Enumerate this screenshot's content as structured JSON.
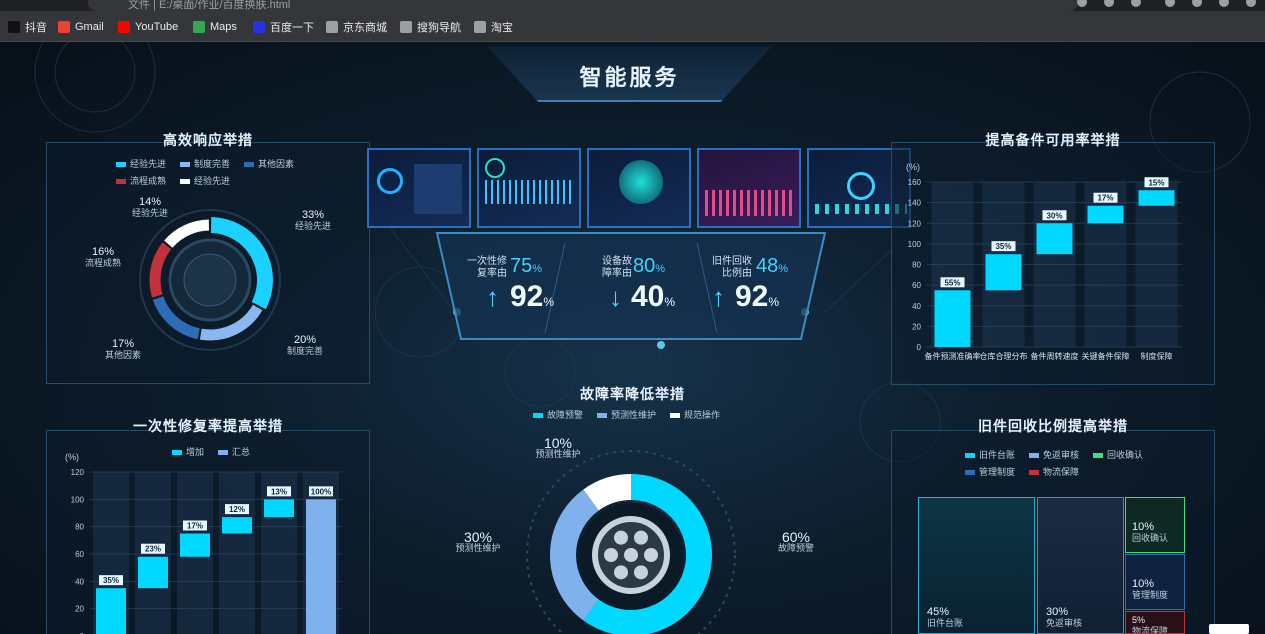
{
  "browser": {
    "url_text": "文件 | E:/桌面/作业/百度换肤.html",
    "bookmarks": [
      {
        "label": "抖音",
        "color": "#111111"
      },
      {
        "label": "Gmail",
        "color": "#ea4335"
      },
      {
        "label": "YouTube",
        "color": "#ff0000"
      },
      {
        "label": "Maps",
        "color": "#34a853"
      },
      {
        "label": "百度一下",
        "color": "#2932e1"
      },
      {
        "label": "京东商城",
        "color": "#9aa0a6"
      },
      {
        "label": "搜狗导航",
        "color": "#9aa0a6"
      },
      {
        "label": "淘宝",
        "color": "#9aa0a6"
      }
    ]
  },
  "header": {
    "title": "智能服务"
  },
  "panels": {
    "efficient": {
      "title": "高效响应举措",
      "legend": [
        "经验先进",
        "制度完善",
        "其他因素",
        "流程成熟",
        "经验先进"
      ],
      "slices": [
        {
          "value": "33%",
          "label": "经验先进"
        },
        {
          "value": "20%",
          "label": "制度完善"
        },
        {
          "value": "17%",
          "label": "其他因素"
        },
        {
          "value": "16%",
          "label": "流程成熟"
        },
        {
          "value": "14%",
          "label": "经验先进"
        }
      ]
    },
    "spare": {
      "title": "提高备件可用率举措",
      "unit": "(%)"
    },
    "repair": {
      "title": "一次性修复率提高举措",
      "unit": "(%)",
      "legend": [
        "增加",
        "汇总"
      ]
    },
    "fault": {
      "title": "故障率降低举措",
      "legend": [
        "故障预警",
        "预测性维护",
        "规范操作"
      ],
      "slices": [
        {
          "value": "10%",
          "label": "预测性维护"
        },
        {
          "value": "30%",
          "label": "预测性维护"
        },
        {
          "value": "60%",
          "label": "故障预警"
        }
      ]
    },
    "recycle": {
      "title": "旧件回收比例提高举措",
      "legend": [
        "旧件台账",
        "免返审核",
        "回收确认",
        "管理制度",
        "物流保障"
      ],
      "cells": [
        {
          "value": "45%",
          "label": "旧件台账"
        },
        {
          "value": "30%",
          "label": "免返审核"
        },
        {
          "value": "10%",
          "label": "回收确认"
        },
        {
          "value": "10%",
          "label": "管理制度"
        },
        {
          "value": "5%",
          "label": "物流保障"
        }
      ]
    }
  },
  "kpis": [
    {
      "label_l1": "一次性修",
      "label_l2": "复率由",
      "from": "75",
      "to": "92",
      "unit": "%",
      "arrow": "↑"
    },
    {
      "label_l1": "设备故",
      "label_l2": "障率由",
      "from": "80",
      "to": "40",
      "unit": "%",
      "arrow": "↓"
    },
    {
      "label_l1": "旧件回收",
      "label_l2": "比例由",
      "from": "48",
      "to": "92",
      "unit": "%",
      "arrow": "↑"
    }
  ],
  "chart_data": [
    {
      "type": "pie",
      "title": "高效响应举措",
      "categories": [
        "经验先进",
        "制度完善",
        "其他因素",
        "流程成熟",
        "经验先进"
      ],
      "values": [
        33,
        20,
        17,
        16,
        14
      ],
      "colors": [
        "#1ad1ff",
        "#8ab7f0",
        "#2d6db8",
        "#c1323c",
        "#ffffff"
      ]
    },
    {
      "type": "bar",
      "title": "提高备件可用率举措",
      "ylabel": "(%)",
      "ylim": [
        0,
        60
      ],
      "yticks": [
        0,
        20,
        40,
        60,
        80,
        100,
        120,
        140,
        160
      ],
      "categories": [
        "备件预测准确率",
        "仓库合理分布",
        "备件周转速度",
        "关键备件保障",
        "制度保障"
      ],
      "series": [
        {
          "values": [
            55,
            35,
            30,
            17,
            15
          ]
        }
      ],
      "bar_labels": [
        "55%",
        "35%",
        "30%",
        "17%",
        "15%"
      ],
      "base": [
        0,
        55,
        90,
        120,
        137
      ],
      "color": "#00d8ff"
    },
    {
      "type": "bar",
      "title": "一次性修复率提高举措",
      "ylabel": "(%)",
      "yticks": [
        0,
        20,
        40,
        60,
        80,
        100,
        120
      ],
      "ylim": [
        0,
        120
      ],
      "series": [
        {
          "name": "增加",
          "values": [
            35,
            23,
            17,
            12,
            13
          ]
        },
        {
          "name": "汇总",
          "values": [
            100
          ]
        }
      ],
      "bar_labels": [
        "35%",
        "23%",
        "17%",
        "12%",
        "13%",
        "100%"
      ],
      "base": [
        0,
        35,
        58,
        75,
        87,
        0
      ],
      "colors": {
        "增加": "#00d8ff",
        "汇总": "#7fb2ec"
      }
    },
    {
      "type": "pie",
      "title": "故障率降低举措",
      "categories": [
        "故障预警",
        "预测性维护",
        "规范操作"
      ],
      "values": [
        60,
        30,
        10
      ],
      "colors": [
        "#00d8ff",
        "#7fb2ec",
        "#ffffff"
      ]
    }
  ]
}
